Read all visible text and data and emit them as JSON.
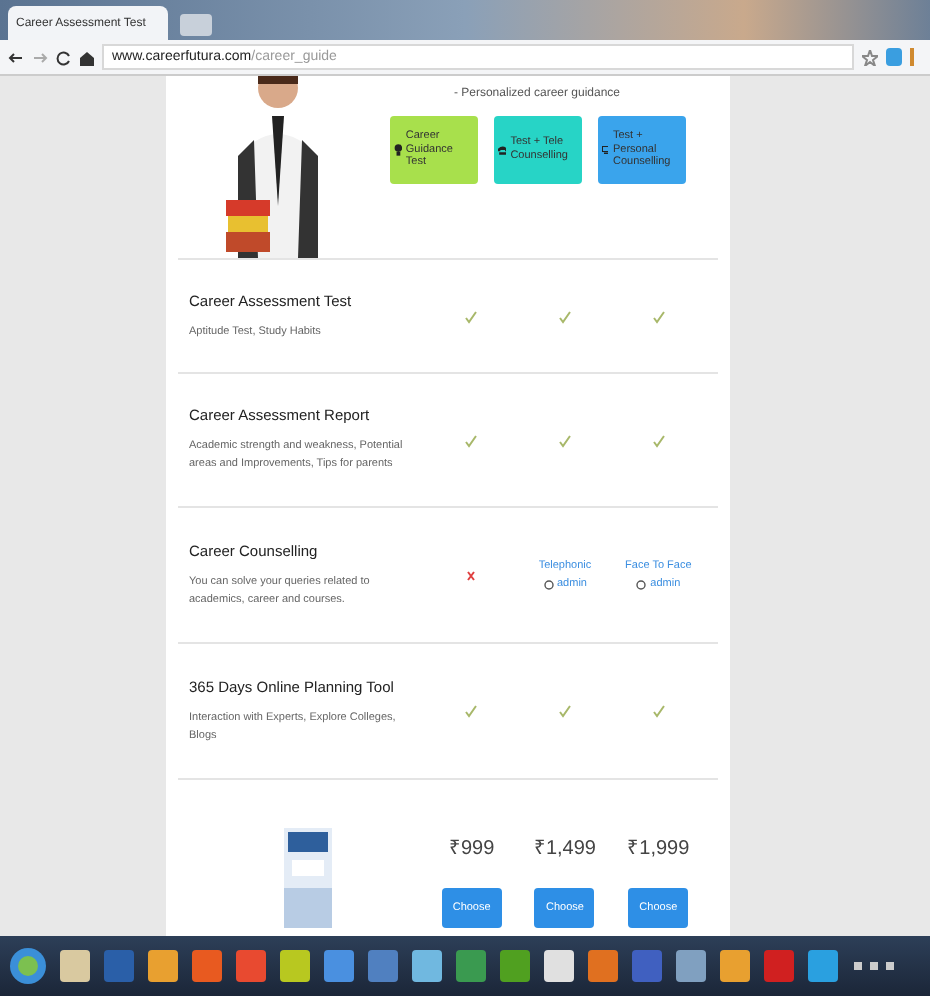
{
  "browser": {
    "tab_title": "Career Assessment Test",
    "url_domain": "www.careerfutura.com",
    "url_path": "/career_guide"
  },
  "header": {
    "subtitle": "- Personalized career guidance",
    "plans": [
      {
        "label": "Career Guidance Test",
        "color": "#a8e04c"
      },
      {
        "label": "Test + Tele Counselling",
        "color": "#27d4c6"
      },
      {
        "label": "Test + Personal Counselling",
        "color": "#3aa4ec"
      }
    ]
  },
  "features": [
    {
      "title": "Career Assessment Test",
      "description": "Aptitude Test, Study Habits",
      "cells": [
        {
          "kind": "check"
        },
        {
          "kind": "check"
        },
        {
          "kind": "check"
        }
      ]
    },
    {
      "title": "Career Assessment Report",
      "description": "Academic strength and weakness, Potential areas and Improvements, Tips for parents",
      "cells": [
        {
          "kind": "check"
        },
        {
          "kind": "check"
        },
        {
          "kind": "check"
        }
      ]
    },
    {
      "title": "Career Counselling",
      "description": "You can solve your queries related to academics, career and courses.",
      "cells": [
        {
          "kind": "cross"
        },
        {
          "kind": "link",
          "text": "Telephonic",
          "note": "admin"
        },
        {
          "kind": "link",
          "text": "Face To Face",
          "note": "admin"
        }
      ]
    },
    {
      "title": "365 Days Online Planning Tool",
      "description": "Interaction with Experts, Explore Colleges, Blogs",
      "cells": [
        {
          "kind": "check"
        },
        {
          "kind": "check"
        },
        {
          "kind": "check"
        }
      ]
    }
  ],
  "prices": [
    {
      "amount": "₹999",
      "button": "Choose"
    },
    {
      "amount": "₹1,499",
      "button": "Choose"
    },
    {
      "amount": "₹1,999",
      "button": "Choose"
    }
  ]
}
